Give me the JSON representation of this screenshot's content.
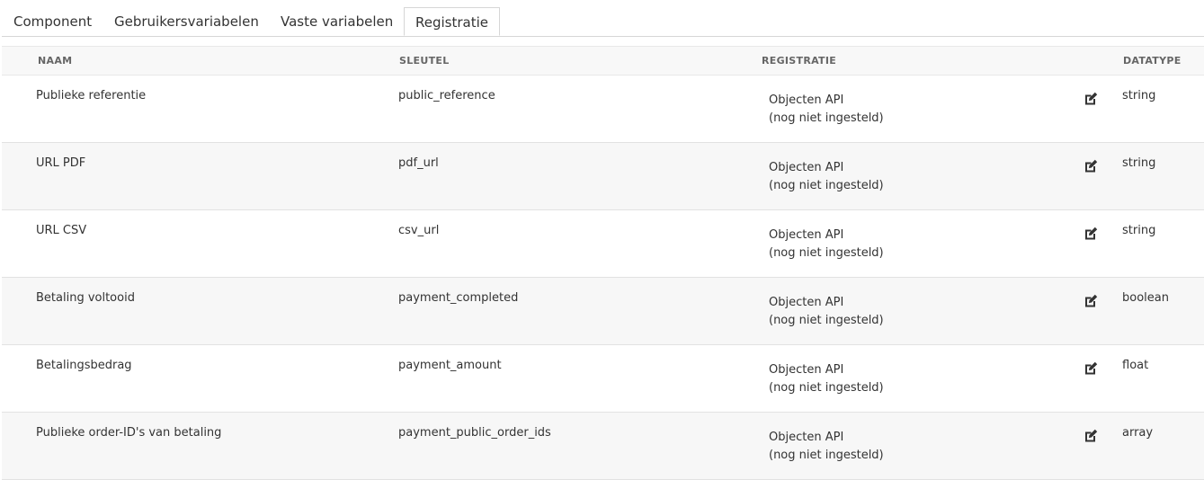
{
  "tabs": [
    {
      "label": "Component",
      "active": false
    },
    {
      "label": "Gebruikersvariabelen",
      "active": false
    },
    {
      "label": "Vaste variabelen",
      "active": false
    },
    {
      "label": "Registratie",
      "active": true
    }
  ],
  "table": {
    "columns": [
      "NAAM",
      "SLEUTEL",
      "REGISTRATIE",
      "DATATYPE"
    ],
    "rows": [
      {
        "name": "Publieke referentie",
        "key": "public_reference",
        "registration": "Objecten API",
        "registration_status": "(nog niet ingesteld)",
        "datatype": "string",
        "edit_icon": "edit-icon"
      },
      {
        "name": "URL PDF",
        "key": "pdf_url",
        "registration": "Objecten API",
        "registration_status": "(nog niet ingesteld)",
        "datatype": "string",
        "edit_icon": "edit-icon"
      },
      {
        "name": "URL CSV",
        "key": "csv_url",
        "registration": "Objecten API",
        "registration_status": "(nog niet ingesteld)",
        "datatype": "string",
        "edit_icon": "edit-icon"
      },
      {
        "name": "Betaling voltooid",
        "key": "payment_completed",
        "registration": "Objecten API",
        "registration_status": "(nog niet ingesteld)",
        "datatype": "boolean",
        "edit_icon": "edit-icon"
      },
      {
        "name": "Betalingsbedrag",
        "key": "payment_amount",
        "registration": "Objecten API",
        "registration_status": "(nog niet ingesteld)",
        "datatype": "float",
        "edit_icon": "edit-icon"
      },
      {
        "name": "Publieke order-ID's van betaling",
        "key": "payment_public_order_ids",
        "registration": "Objecten API",
        "registration_status": "(nog niet ingesteld)",
        "datatype": "array",
        "edit_icon": "edit-icon"
      }
    ]
  },
  "colors": {
    "text": "#333333",
    "header_text": "#666666",
    "border": "#d6d6d6",
    "row_alt_bg": "#f7f7f7"
  }
}
